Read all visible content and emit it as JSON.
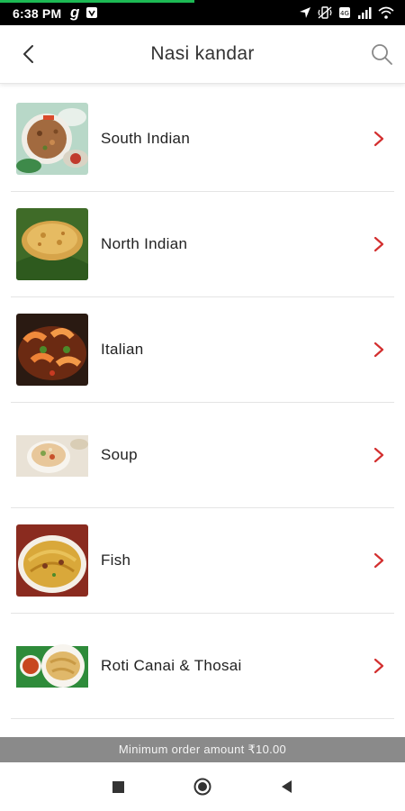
{
  "status_bar": {
    "time": "6:38 PM",
    "app_letter": "g",
    "icons": [
      "location-icon",
      "vibrate-icon",
      "data-icon",
      "signal-icon",
      "wifi-icon"
    ]
  },
  "header": {
    "title": "Nasi kandar",
    "back_icon": "back-arrow-icon",
    "search_icon": "search-icon"
  },
  "categories": [
    {
      "label": "South Indian",
      "image": "south-indian-food-thumbnail"
    },
    {
      "label": "North Indian",
      "image": "north-indian-food-thumbnail"
    },
    {
      "label": "Italian",
      "image": "italian-food-thumbnail"
    },
    {
      "label": "Soup",
      "image": "soup-thumbnail"
    },
    {
      "label": "Fish",
      "image": "fish-dish-thumbnail"
    },
    {
      "label": "Roti Canai & Thosai",
      "image": "roti-canai-thumbnail"
    }
  ],
  "footer": {
    "minimum_order": "Minimum order amount ₹10.00"
  },
  "nav": {
    "icons": [
      "recents-icon",
      "home-icon",
      "back-icon"
    ]
  },
  "colors": {
    "accent": "#d32f2f",
    "status_bar": "#000000",
    "footer_bar": "#8a8a8a"
  }
}
